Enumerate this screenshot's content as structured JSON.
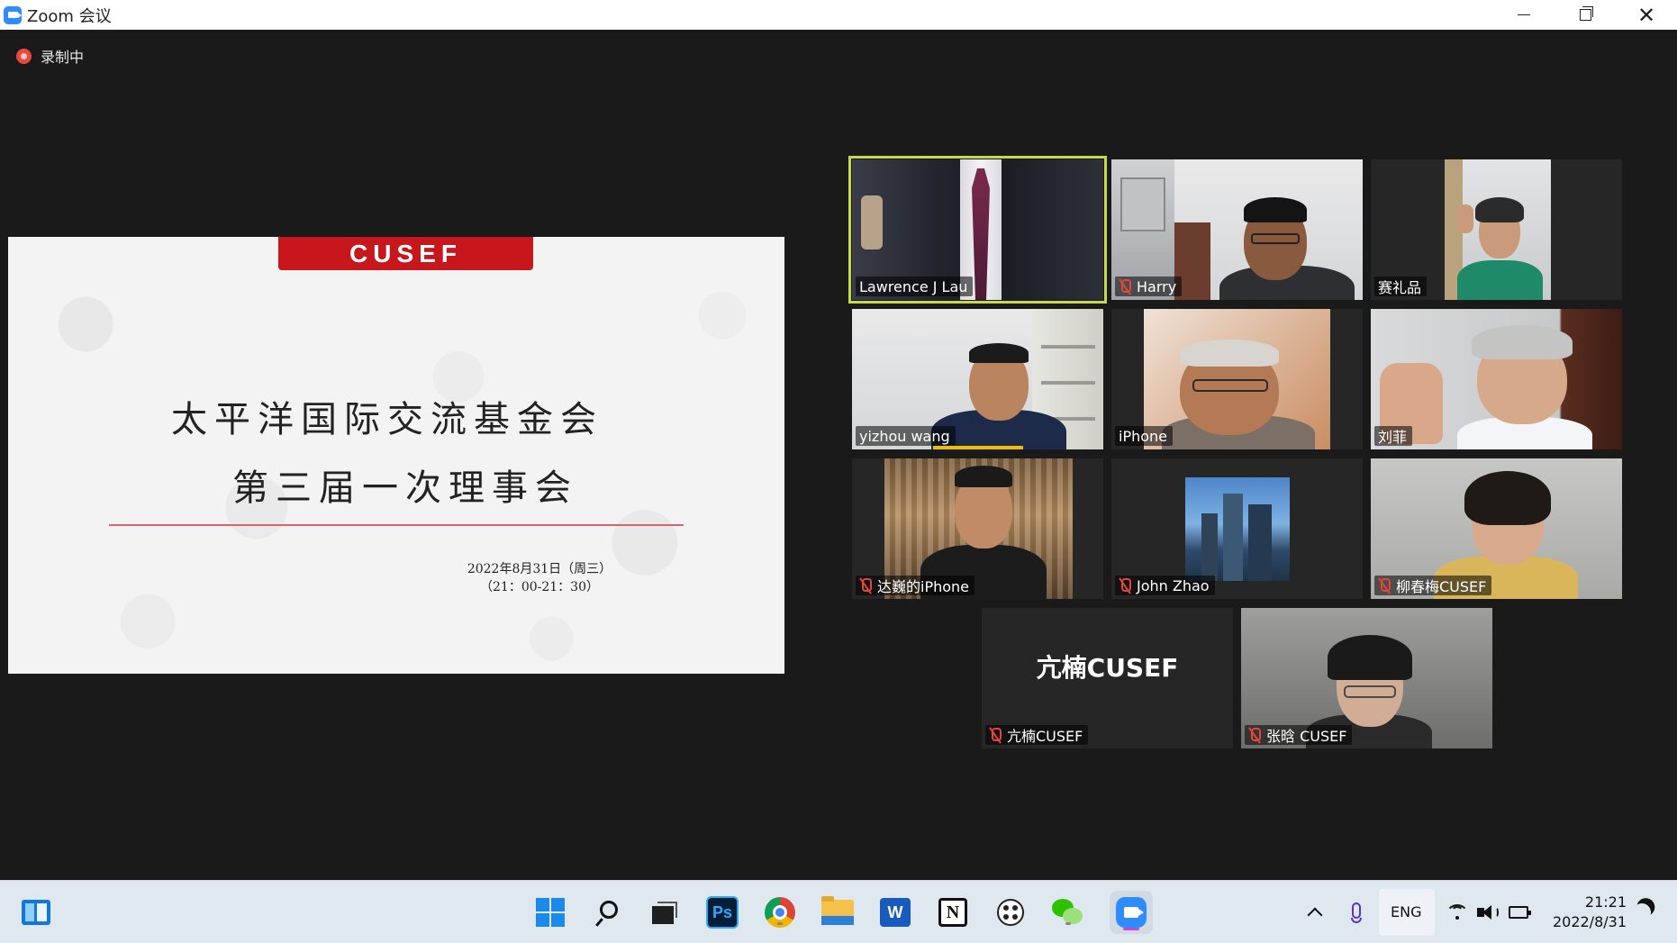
{
  "window": {
    "title": "Zoom 会议",
    "minimize_glyph": "",
    "close_glyph": "✕"
  },
  "recording": {
    "label": "录制中"
  },
  "slide": {
    "brand": "CUSEF",
    "title_line1": "太平洋国际交流基金会",
    "title_line2": "第三届一次理事会",
    "date": "2022年8月31日（周三）",
    "time": "（21：00-21：30）"
  },
  "participants": [
    {
      "name": "Lawrence J Lau",
      "muted": false,
      "active_speaker": true
    },
    {
      "name": "Harry",
      "muted": true
    },
    {
      "name": "赛礼品",
      "muted": false
    },
    {
      "name": "yizhou wang",
      "muted": false,
      "talking": true
    },
    {
      "name": "iPhone",
      "muted": false
    },
    {
      "name": "刘菲",
      "muted": false
    },
    {
      "name": "达巍的iPhone",
      "muted": true
    },
    {
      "name": "John Zhao",
      "muted": true
    },
    {
      "name": "柳春梅CUSEF",
      "muted": true
    },
    {
      "name": "亢楠CUSEF",
      "muted": true,
      "avatar_text": "亢楠CUSEF"
    },
    {
      "name": "张晗 CUSEF",
      "muted": true
    }
  ],
  "taskbar": {
    "language": "ENG",
    "time": "21:21",
    "date": "2022/8/31",
    "icons": [
      "widgets-icon",
      "start-icon",
      "search-icon",
      "task-view-icon",
      "photoshop-icon",
      "chrome-icon",
      "file-explorer-icon",
      "word-icon",
      "notion-icon",
      "connect-icon",
      "wechat-icon",
      "zoom-icon"
    ],
    "photoshop_label": "Ps",
    "word_label": "W",
    "notion_label": "N",
    "colors": {
      "zoom": "#2d8cff",
      "photoshop": "#001e36",
      "word": "#185abd",
      "wechat": "#2dc100"
    }
  }
}
